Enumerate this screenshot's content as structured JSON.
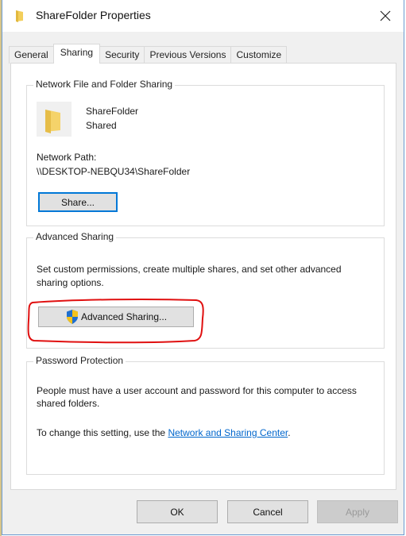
{
  "window": {
    "title": "ShareFolder Properties",
    "title_icon": "folder-icon",
    "close_icon": "close-icon"
  },
  "tabs": [
    {
      "label": "General",
      "active": false
    },
    {
      "label": "Sharing",
      "active": true
    },
    {
      "label": "Security",
      "active": false
    },
    {
      "label": "Previous Versions",
      "active": false
    },
    {
      "label": "Customize",
      "active": false
    }
  ],
  "network_sharing": {
    "group_title": "Network File and Folder Sharing",
    "folder_name": "ShareFolder",
    "folder_status": "Shared",
    "path_label": "Network Path:",
    "path_value": "\\\\DESKTOP-NEBQU34\\ShareFolder",
    "share_button": "Share..."
  },
  "advanced_sharing": {
    "group_title": "Advanced Sharing",
    "description": "Set custom permissions, create multiple shares, and set other advanced sharing options.",
    "button_label": "Advanced Sharing...",
    "button_icon": "uac-shield-icon",
    "highlight_color": "#e01010"
  },
  "password_protection": {
    "group_title": "Password Protection",
    "description": "People must have a user account and password for this computer to access shared folders.",
    "change_prefix": "To change this setting, use the ",
    "link_text": "Network and Sharing Center",
    "change_suffix": "."
  },
  "footer": {
    "ok": "OK",
    "cancel": "Cancel",
    "apply": "Apply",
    "apply_enabled": false
  },
  "colors": {
    "accent": "#0078d7",
    "link": "#0066cc",
    "folder": "#f3cf5b"
  }
}
